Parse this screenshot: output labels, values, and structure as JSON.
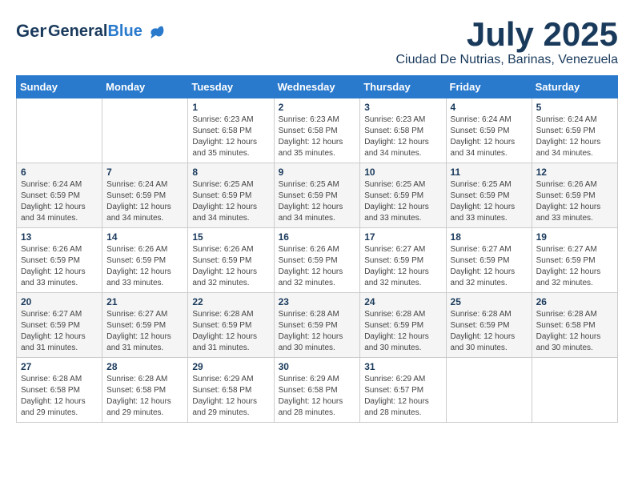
{
  "header": {
    "logo_general": "General",
    "logo_blue": "Blue",
    "month": "July 2025",
    "location": "Ciudad De Nutrias, Barinas, Venezuela"
  },
  "weekdays": [
    "Sunday",
    "Monday",
    "Tuesday",
    "Wednesday",
    "Thursday",
    "Friday",
    "Saturday"
  ],
  "weeks": [
    [
      {
        "day": "",
        "sunrise": "",
        "sunset": "",
        "daylight": ""
      },
      {
        "day": "",
        "sunrise": "",
        "sunset": "",
        "daylight": ""
      },
      {
        "day": "1",
        "sunrise": "Sunrise: 6:23 AM",
        "sunset": "Sunset: 6:58 PM",
        "daylight": "Daylight: 12 hours and 35 minutes."
      },
      {
        "day": "2",
        "sunrise": "Sunrise: 6:23 AM",
        "sunset": "Sunset: 6:58 PM",
        "daylight": "Daylight: 12 hours and 35 minutes."
      },
      {
        "day": "3",
        "sunrise": "Sunrise: 6:23 AM",
        "sunset": "Sunset: 6:58 PM",
        "daylight": "Daylight: 12 hours and 34 minutes."
      },
      {
        "day": "4",
        "sunrise": "Sunrise: 6:24 AM",
        "sunset": "Sunset: 6:59 PM",
        "daylight": "Daylight: 12 hours and 34 minutes."
      },
      {
        "day": "5",
        "sunrise": "Sunrise: 6:24 AM",
        "sunset": "Sunset: 6:59 PM",
        "daylight": "Daylight: 12 hours and 34 minutes."
      }
    ],
    [
      {
        "day": "6",
        "sunrise": "Sunrise: 6:24 AM",
        "sunset": "Sunset: 6:59 PM",
        "daylight": "Daylight: 12 hours and 34 minutes."
      },
      {
        "day": "7",
        "sunrise": "Sunrise: 6:24 AM",
        "sunset": "Sunset: 6:59 PM",
        "daylight": "Daylight: 12 hours and 34 minutes."
      },
      {
        "day": "8",
        "sunrise": "Sunrise: 6:25 AM",
        "sunset": "Sunset: 6:59 PM",
        "daylight": "Daylight: 12 hours and 34 minutes."
      },
      {
        "day": "9",
        "sunrise": "Sunrise: 6:25 AM",
        "sunset": "Sunset: 6:59 PM",
        "daylight": "Daylight: 12 hours and 34 minutes."
      },
      {
        "day": "10",
        "sunrise": "Sunrise: 6:25 AM",
        "sunset": "Sunset: 6:59 PM",
        "daylight": "Daylight: 12 hours and 33 minutes."
      },
      {
        "day": "11",
        "sunrise": "Sunrise: 6:25 AM",
        "sunset": "Sunset: 6:59 PM",
        "daylight": "Daylight: 12 hours and 33 minutes."
      },
      {
        "day": "12",
        "sunrise": "Sunrise: 6:26 AM",
        "sunset": "Sunset: 6:59 PM",
        "daylight": "Daylight: 12 hours and 33 minutes."
      }
    ],
    [
      {
        "day": "13",
        "sunrise": "Sunrise: 6:26 AM",
        "sunset": "Sunset: 6:59 PM",
        "daylight": "Daylight: 12 hours and 33 minutes."
      },
      {
        "day": "14",
        "sunrise": "Sunrise: 6:26 AM",
        "sunset": "Sunset: 6:59 PM",
        "daylight": "Daylight: 12 hours and 33 minutes."
      },
      {
        "day": "15",
        "sunrise": "Sunrise: 6:26 AM",
        "sunset": "Sunset: 6:59 PM",
        "daylight": "Daylight: 12 hours and 32 minutes."
      },
      {
        "day": "16",
        "sunrise": "Sunrise: 6:26 AM",
        "sunset": "Sunset: 6:59 PM",
        "daylight": "Daylight: 12 hours and 32 minutes."
      },
      {
        "day": "17",
        "sunrise": "Sunrise: 6:27 AM",
        "sunset": "Sunset: 6:59 PM",
        "daylight": "Daylight: 12 hours and 32 minutes."
      },
      {
        "day": "18",
        "sunrise": "Sunrise: 6:27 AM",
        "sunset": "Sunset: 6:59 PM",
        "daylight": "Daylight: 12 hours and 32 minutes."
      },
      {
        "day": "19",
        "sunrise": "Sunrise: 6:27 AM",
        "sunset": "Sunset: 6:59 PM",
        "daylight": "Daylight: 12 hours and 32 minutes."
      }
    ],
    [
      {
        "day": "20",
        "sunrise": "Sunrise: 6:27 AM",
        "sunset": "Sunset: 6:59 PM",
        "daylight": "Daylight: 12 hours and 31 minutes."
      },
      {
        "day": "21",
        "sunrise": "Sunrise: 6:27 AM",
        "sunset": "Sunset: 6:59 PM",
        "daylight": "Daylight: 12 hours and 31 minutes."
      },
      {
        "day": "22",
        "sunrise": "Sunrise: 6:28 AM",
        "sunset": "Sunset: 6:59 PM",
        "daylight": "Daylight: 12 hours and 31 minutes."
      },
      {
        "day": "23",
        "sunrise": "Sunrise: 6:28 AM",
        "sunset": "Sunset: 6:59 PM",
        "daylight": "Daylight: 12 hours and 30 minutes."
      },
      {
        "day": "24",
        "sunrise": "Sunrise: 6:28 AM",
        "sunset": "Sunset: 6:59 PM",
        "daylight": "Daylight: 12 hours and 30 minutes."
      },
      {
        "day": "25",
        "sunrise": "Sunrise: 6:28 AM",
        "sunset": "Sunset: 6:59 PM",
        "daylight": "Daylight: 12 hours and 30 minutes."
      },
      {
        "day": "26",
        "sunrise": "Sunrise: 6:28 AM",
        "sunset": "Sunset: 6:58 PM",
        "daylight": "Daylight: 12 hours and 30 minutes."
      }
    ],
    [
      {
        "day": "27",
        "sunrise": "Sunrise: 6:28 AM",
        "sunset": "Sunset: 6:58 PM",
        "daylight": "Daylight: 12 hours and 29 minutes."
      },
      {
        "day": "28",
        "sunrise": "Sunrise: 6:28 AM",
        "sunset": "Sunset: 6:58 PM",
        "daylight": "Daylight: 12 hours and 29 minutes."
      },
      {
        "day": "29",
        "sunrise": "Sunrise: 6:29 AM",
        "sunset": "Sunset: 6:58 PM",
        "daylight": "Daylight: 12 hours and 29 minutes."
      },
      {
        "day": "30",
        "sunrise": "Sunrise: 6:29 AM",
        "sunset": "Sunset: 6:58 PM",
        "daylight": "Daylight: 12 hours and 28 minutes."
      },
      {
        "day": "31",
        "sunrise": "Sunrise: 6:29 AM",
        "sunset": "Sunset: 6:57 PM",
        "daylight": "Daylight: 12 hours and 28 minutes."
      },
      {
        "day": "",
        "sunrise": "",
        "sunset": "",
        "daylight": ""
      },
      {
        "day": "",
        "sunrise": "",
        "sunset": "",
        "daylight": ""
      }
    ]
  ]
}
